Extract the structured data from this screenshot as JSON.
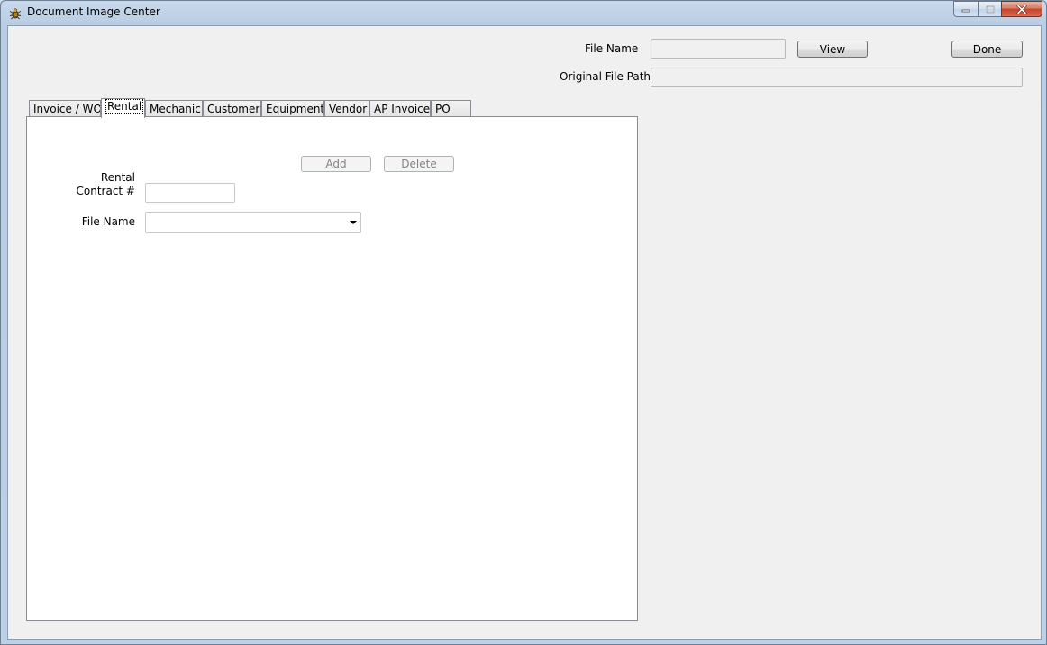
{
  "window": {
    "title": "Document Image Center"
  },
  "header": {
    "file_name_label": "File Name",
    "file_name_value": "",
    "view_label": "View",
    "done_label": "Done",
    "original_path_label": "Original File Path",
    "original_path_value": ""
  },
  "tabs": [
    {
      "label": "Invoice / WO",
      "selected": false
    },
    {
      "label": "Rental",
      "selected": true
    },
    {
      "label": "Mechanic",
      "selected": false
    },
    {
      "label": "Customer",
      "selected": false
    },
    {
      "label": "Equipment",
      "selected": false
    },
    {
      "label": "Vendor",
      "selected": false
    },
    {
      "label": "AP Invoice",
      "selected": false
    },
    {
      "label": "PO",
      "selected": false
    }
  ],
  "rental": {
    "add_label": "Add",
    "delete_label": "Delete",
    "contract_label_line1": "Rental",
    "contract_label_line2": "Contract #",
    "contract_value": "",
    "file_name_label": "File Name",
    "file_name_selected": ""
  },
  "icons": {
    "app": "bug-icon",
    "minimize": "minimize-icon",
    "maximize": "maximize-icon",
    "close": "close-icon",
    "dropdown": "chevron-down-icon"
  }
}
